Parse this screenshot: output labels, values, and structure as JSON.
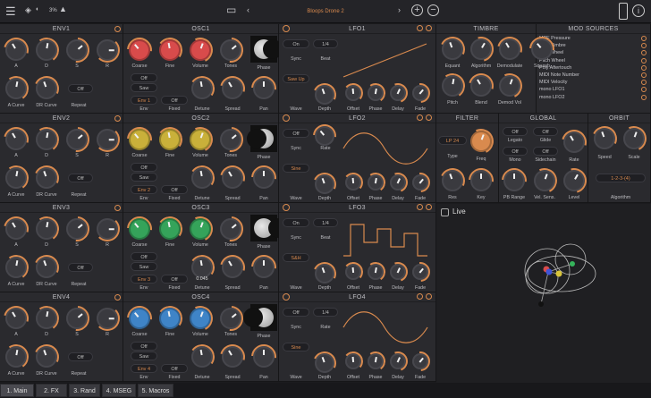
{
  "topbar": {
    "percent": "3%",
    "preset": "Bloops Drone 2"
  },
  "env": [
    {
      "title": "ENV1",
      "repeat": "Off",
      "labels": [
        "A",
        "D",
        "S",
        "R",
        "A Curve",
        "DR Curve",
        "Repeat"
      ]
    },
    {
      "title": "ENV2",
      "repeat": "Off",
      "labels": [
        "A",
        "D",
        "S",
        "R",
        "A Curve",
        "DR Curve",
        "Repeat"
      ]
    },
    {
      "title": "ENV3",
      "repeat": "Off",
      "labels": [
        "A",
        "D",
        "S",
        "R",
        "A Curve",
        "DR Curve",
        "Repeat"
      ]
    },
    {
      "title": "ENV4",
      "repeat": "Off",
      "labels": [
        "A",
        "D",
        "S",
        "R",
        "A Curve",
        "DR Curve",
        "Repeat"
      ]
    }
  ],
  "osc": [
    {
      "title": "OSC1",
      "color": "#d84b4b",
      "b1": "Off",
      "b2": "Saw",
      "b3": "Env 1",
      "b4": "Off",
      "detune": "",
      "labels": [
        "Coarse",
        "Fine",
        "Volume",
        "Tones",
        "Phase",
        "Env",
        "Fixed",
        "Detune",
        "Spread",
        "Pan"
      ]
    },
    {
      "title": "OSC2",
      "color": "#c9b03a",
      "b1": "Off",
      "b2": "Saw",
      "b3": "Env 2",
      "b4": "Off",
      "detune": "",
      "labels": [
        "Coarse",
        "Fine",
        "Volume",
        "Tones",
        "Phase",
        "Env",
        "Fixed",
        "Detune",
        "Spread",
        "Pan"
      ]
    },
    {
      "title": "OSC3",
      "color": "#35a35a",
      "b1": "Off",
      "b2": "Saw",
      "b3": "Env 3",
      "b4": "Off",
      "detune": "0.045",
      "labels": [
        "Coarse",
        "Fine",
        "Volume",
        "Tones",
        "Phase",
        "Env",
        "Fixed",
        "Detune",
        "Spread",
        "Pan"
      ]
    },
    {
      "title": "OSC4",
      "color": "#3f84c7",
      "b1": "Off",
      "b2": "Saw",
      "b3": "Env 4",
      "b4": "Off",
      "detune": "",
      "labels": [
        "Coarse",
        "Fine",
        "Volume",
        "Tones",
        "Phase",
        "Env",
        "Fixed",
        "Detune",
        "Spread",
        "Pan"
      ]
    }
  ],
  "lfo": [
    {
      "title": "LFO1",
      "b1": "On",
      "b2": "1/4",
      "b3": "Sync",
      "b4": "Beat",
      "b5": "Saw Up",
      "labels": [
        "Wave",
        "Depth",
        "Offset",
        "Phase",
        "Delay",
        "Fade"
      ]
    },
    {
      "title": "LFO2",
      "b1": "Off",
      "b2": "",
      "b3": "Sync",
      "b4": "Rate",
      "b5": "Sine",
      "labels": [
        "Wave",
        "Depth",
        "Offset",
        "Phase",
        "Delay",
        "Fade"
      ]
    },
    {
      "title": "LFO3",
      "b1": "On",
      "b2": "1/4",
      "b3": "Sync",
      "b4": "Beat",
      "b5": "S&H",
      "labels": [
        "Wave",
        "Depth",
        "Offset",
        "Phase",
        "Delay",
        "Fade"
      ]
    },
    {
      "title": "LFO4",
      "b1": "Off",
      "b2": "1/4",
      "b3": "Sync",
      "b4": "Rate",
      "b5": "Sine",
      "labels": [
        "Wave",
        "Depth",
        "Offset",
        "Phase",
        "Delay",
        "Fade"
      ]
    }
  ],
  "timbre": {
    "title": "TIMBRE",
    "labels": [
      "Equant",
      "Algorithm",
      "Demodulate",
      "Squash",
      "Pitch",
      "Blend",
      "Demod Vol"
    ]
  },
  "mod_sources": {
    "title": "MOD SOURCES",
    "items": [
      "MPE Pressure",
      "MPE Timbre",
      "Mod Wheel",
      "Pitch Wheel",
      "Poly Aftertouch",
      "MIDI Note Number",
      "MIDI Velocity",
      "mono LFO1",
      "mono LFO2"
    ]
  },
  "filter": {
    "title": "FILTER",
    "type": "LP 24",
    "labels": [
      "Type",
      "Freq",
      "Res",
      "Key"
    ]
  },
  "global": {
    "title": "GLOBAL",
    "b1": "Off",
    "b2": "Off",
    "b3": "Legato",
    "b4": "Glide",
    "b5": "Off",
    "b6": "Off",
    "labels": [
      "Mono",
      "Sidechain",
      "Rate",
      "PB Range",
      "Vel. Sens.",
      "Level"
    ]
  },
  "orbit": {
    "title": "ORBIT",
    "algo": "1-2-3-(4)",
    "labels": [
      "Speed",
      "Scale",
      "Algorithm"
    ]
  },
  "live": {
    "label": "Live"
  },
  "tabs": [
    "1. Main",
    "2. FX",
    "3. Rand",
    "4. MSEG",
    "5. Macros"
  ]
}
